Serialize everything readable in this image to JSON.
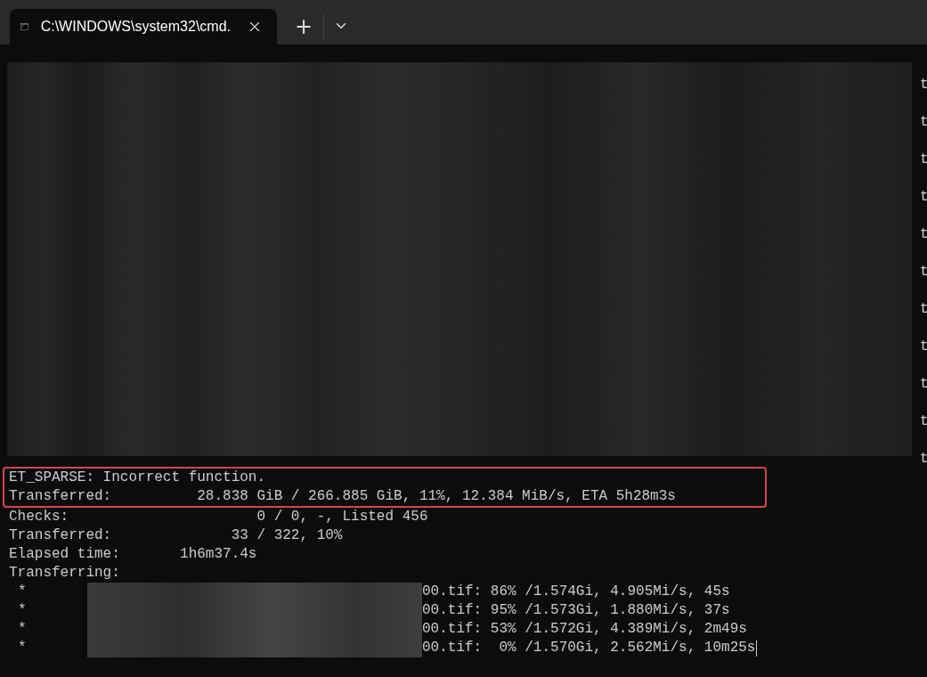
{
  "tabs": [
    {
      "title": "C:\\WINDOWS\\system32\\cmd.",
      "selected": true
    }
  ],
  "new_tab": "+",
  "terminal": {
    "edge_chars": [
      "t",
      "t",
      "t",
      "t",
      "t",
      "t",
      "t",
      "t",
      "t",
      "t",
      "t"
    ],
    "lines": [
      {
        "text": "ET_SPARSE: Incorrect function.",
        "highlighted": true
      },
      {
        "text": "Transferred:          28.838 GiB / 266.885 GiB, 11%, 12.384 MiB/s, ETA 5h28m3s",
        "highlighted": true
      },
      {
        "text": "Checks:                      0 / 0, -, Listed 456",
        "highlighted": false
      },
      {
        "text": "Transferred:              33 / 322, 10%",
        "highlighted": false
      },
      {
        "text": "Elapsed time:       1h6m37.4s",
        "highlighted": false
      },
      {
        "text": "Transferring:",
        "highlighted": false
      }
    ],
    "transfers": [
      {
        "bullet": "*",
        "text": "00.tif: 86% /1.574Gi, 4.905Mi/s, 45s"
      },
      {
        "bullet": "*",
        "text": "00.tif: 95% /1.573Gi, 1.880Mi/s, 37s"
      },
      {
        "bullet": "*",
        "text": "00.tif: 53% /1.572Gi, 4.389Mi/s, 2m49s"
      },
      {
        "bullet": "*",
        "text": "00.tif:  0% /1.570Gi, 2.562Mi/s, 10m25s"
      }
    ],
    "cursor": true
  }
}
